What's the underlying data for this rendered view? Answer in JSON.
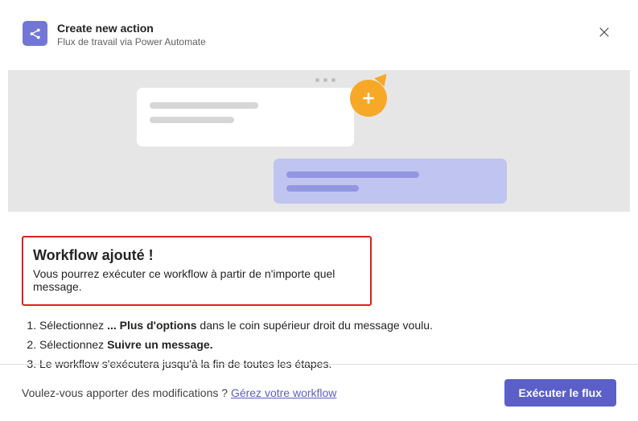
{
  "header": {
    "title": "Create new action",
    "subtitle": "Flux de travail via Power Automate"
  },
  "success": {
    "title": "Workflow ajouté !",
    "description": "Vous pourrez exécuter ce workflow à partir de n'importe quel message."
  },
  "instructions": {
    "step1_prefix": "Sélectionnez ",
    "step1_bold": "... Plus d'options",
    "step1_suffix": " dans le coin supérieur droit du message voulu.",
    "step2_prefix": "Sélectionnez ",
    "step2_bold": "Suivre un message.",
    "step3": "Le workflow s'exécutera jusqu'à la fin de toutes les étapes."
  },
  "footer": {
    "question": "Voulez-vous apporter des modifications ? ",
    "link": "Gérez votre workflow",
    "button": "Exécuter le flux"
  }
}
